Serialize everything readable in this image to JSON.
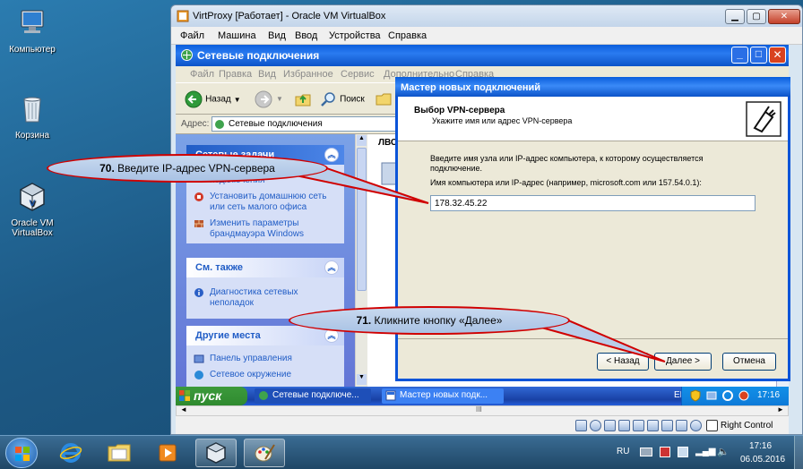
{
  "desktop": {
    "icons": [
      {
        "label": "Компьютер"
      },
      {
        "label": "Корзина"
      },
      {
        "label": "Oracle VM VirtualBox"
      }
    ]
  },
  "vbox": {
    "title": "VirtProxy [Работает] - Oracle VM VirtualBox",
    "menu": [
      "Файл",
      "Машина",
      "Вид",
      "Ввод",
      "Устройства",
      "Справка"
    ],
    "status_host_key": "Right Control",
    "scroll_label": "III"
  },
  "explorer": {
    "title": "Сетевые подключения",
    "menu": [
      "Файл",
      "Правка",
      "Вид",
      "Избранное",
      "Сервис",
      "Дополнительно",
      "Справка"
    ],
    "back_label": "Назад",
    "search_label": "Поиск",
    "address_label": "Адрес:",
    "address_value": "Сетевые подключения",
    "right_header": "ЛВС",
    "panels": {
      "network_tasks": {
        "title": "Сетевые задачи",
        "items": [
          "подключения",
          "Установить домашнюю сеть или сеть малого офиса",
          "Изменить параметры брандмауэра Windows"
        ]
      },
      "see_also": {
        "title": "См. также",
        "items": [
          "Диагностика сетевых неполадок"
        ]
      },
      "other_places": {
        "title": "Другие места",
        "items": [
          "Панель управления",
          "Сетевое окружение"
        ]
      }
    }
  },
  "xp_taskbar": {
    "start": "пуск",
    "items": [
      "Сетевые подключе...",
      "Мастер новых подк..."
    ],
    "lang": "EN",
    "time": "17:16"
  },
  "wizard": {
    "title": "Мастер новых подключений",
    "header_title": "Выбор VPN-сервера",
    "header_subtitle": "Укажите имя или адрес VPN-сервера",
    "description": "Введите имя узла или IP-адрес компьютера, к  которому осуществляется подключение.",
    "field_label": "Имя компьютера или IP-адрес (например, microsoft.com или 157.54.0.1):",
    "field_value": "178.32.45.22",
    "back_button": "< Назад",
    "next_button": "Далее >",
    "cancel_button": "Отмена"
  },
  "callouts": {
    "c70_num": "70.",
    "c70_text": "Введите IP-адрес VPN-сервера",
    "c71_num": "71.",
    "c71_text": "Кликните кнопку «Далее»"
  },
  "host_taskbar": {
    "lang": "RU",
    "time": "17:16",
    "date": "06.05.2016"
  },
  "colors": {
    "xp_blue": "#0a5ddc",
    "callout_border": "#d00000"
  }
}
